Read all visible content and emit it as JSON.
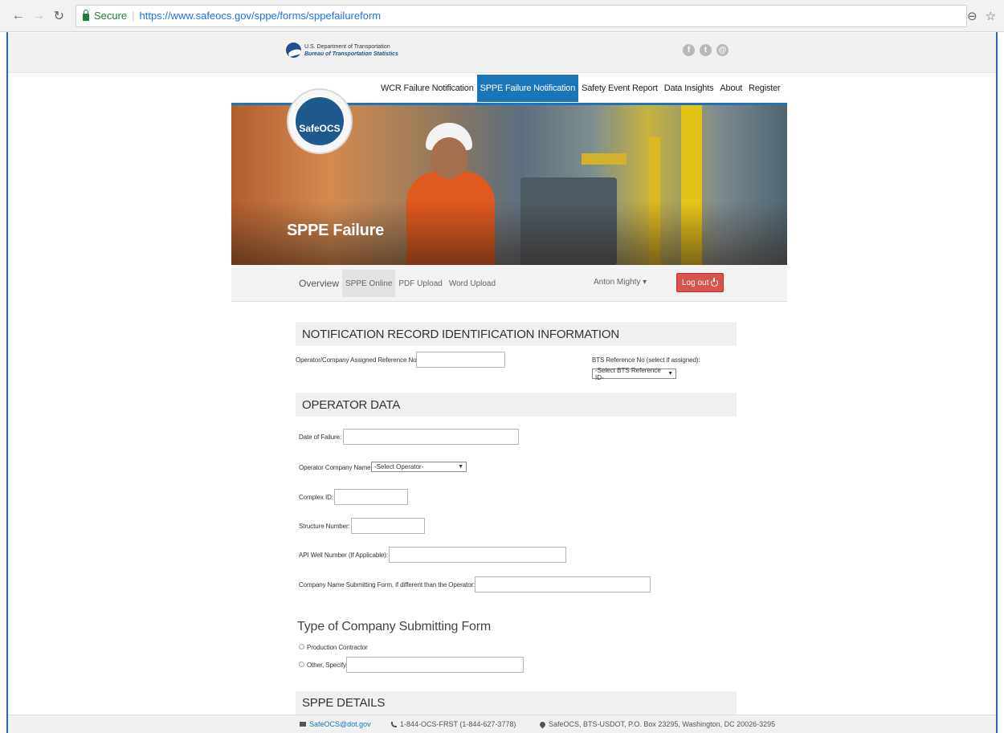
{
  "browser": {
    "secure_label": "Secure",
    "url": "https://www.safeocs.gov/sppe/forms/sppefailureform"
  },
  "header": {
    "dot_line1": "U.S. Department of Transportation",
    "dot_line2": "Bureau of Transportation Statistics",
    "social_icons": [
      "facebook-icon",
      "twitter-icon",
      "email-icon"
    ]
  },
  "nav": {
    "items": [
      {
        "label": "WCR Failure Notification"
      },
      {
        "label": "SPPE Failure Notification"
      },
      {
        "label": "Safety Event Report"
      },
      {
        "label": "Data Insights"
      },
      {
        "label": "About"
      },
      {
        "label": "Register"
      }
    ]
  },
  "hero": {
    "badge": "SafeOCS",
    "title": "SPPE Failure"
  },
  "subnav": {
    "tabs": [
      {
        "label": "Overview"
      },
      {
        "label": "SPPE Online"
      },
      {
        "label": "PDF Upload"
      },
      {
        "label": "Word Upload"
      }
    ],
    "user": "Anton Mighty",
    "logout": "Log out"
  },
  "form": {
    "section1": {
      "title": "NOTIFICATION RECORD IDENTIFICATION INFORMATION",
      "ref_label": "Operator/Company Assigned Reference No:",
      "ref_value": "",
      "bts_label": "BTS Reference No (select if assigned):",
      "bts_select": "-Select BTS Reference ID-"
    },
    "section2": {
      "title": "OPERATOR DATA",
      "date_label": "Date of Failure:",
      "operator_label": "Operator Company Name:",
      "operator_select": "-Select Operator-",
      "complex_label": "Complex ID:",
      "structure_label": "Structure Number:",
      "api_label": "API Well Number (If Applicable):",
      "company_label": "Company Name Submitting Form, if different than the Operator:"
    },
    "type_section": {
      "title": "Type of Company Submitting Form",
      "option1": "Production Contractor",
      "option2": "Other, Specify:"
    },
    "section3": {
      "title": "SPPE DETAILS"
    }
  },
  "footer": {
    "email": "SafeOCS@dot.gov",
    "phone": "1-844-OCS-FRST (1-844-627-3778)",
    "address": "SafeOCS, BTS-USDOT, P.O. Box 23295, Washington, DC 20026-3295"
  }
}
